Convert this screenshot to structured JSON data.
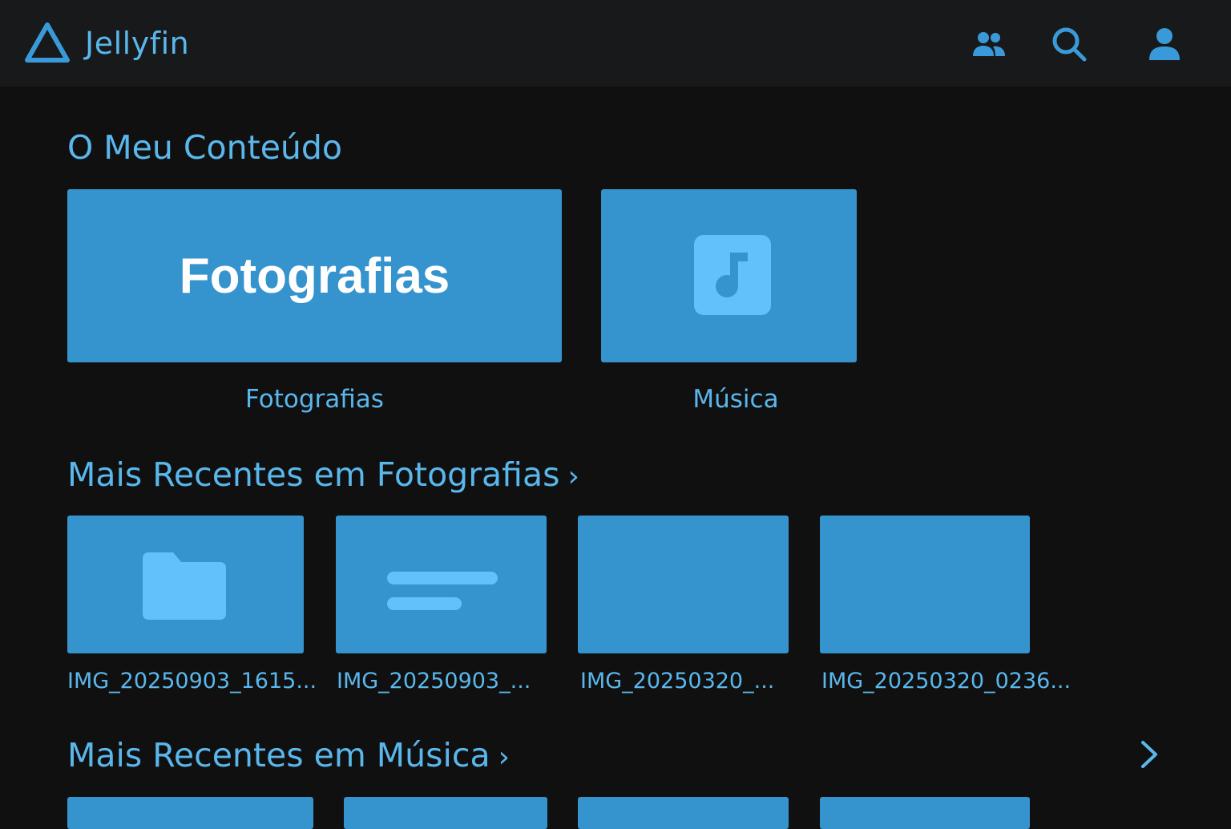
{
  "header": {
    "app_title": "Jellyfin",
    "logo_icon": "jellyfin-triangle-icon",
    "buttons": [
      {
        "name": "users",
        "icon": "users-icon"
      },
      {
        "name": "search",
        "icon": "search-icon"
      },
      {
        "name": "user",
        "icon": "user-icon"
      }
    ]
  },
  "my_content": {
    "title": "O Meu Conteúdo",
    "libraries": [
      {
        "label": "Fotografias",
        "card_text": "Fotografias"
      },
      {
        "label": "Música",
        "icon": "music-note-icon"
      }
    ]
  },
  "recent_photos": {
    "title": "Mais Recentes em Fotografias",
    "chevron": "›",
    "items": [
      {
        "label": "IMG_20250903_1615...",
        "icon": "folder-icon"
      },
      {
        "label": "IMG_20250903_...",
        "icon": "text-lines-icon"
      },
      {
        "label": "IMG_20250320_..."
      },
      {
        "label": "IMG_20250320_0236..."
      }
    ]
  },
  "recent_music": {
    "title": "Mais Recentes em Música",
    "chevron": "›",
    "scroll_right_icon": "chevron-right-icon"
  },
  "colors": {
    "background": "#101011",
    "topbar": "#18191b",
    "accent": "#5ab7ec",
    "card": "#3593cd",
    "card_icon": "#62c1fb"
  }
}
